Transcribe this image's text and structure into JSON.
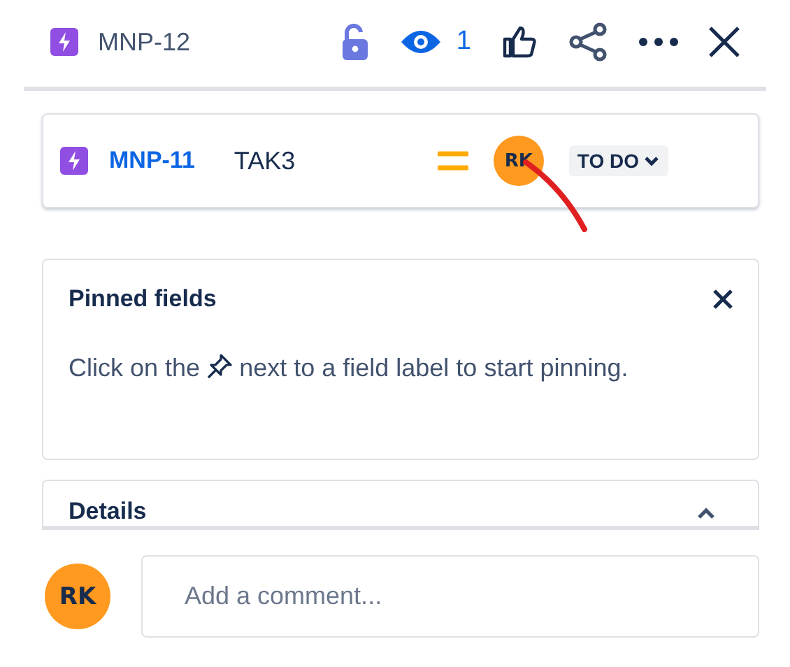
{
  "header": {
    "issue_key": "MNP-12",
    "watchers": "1"
  },
  "child_issue": {
    "key": "MNP-11",
    "summary": "TAK3",
    "assignee": "RK",
    "status": "TO DO"
  },
  "pinned_fields": {
    "title": "Pinned fields",
    "text_before": "Click on the",
    "text_after": "next to a field label to start pinning."
  },
  "details": {
    "title": "Details",
    "expanded": true
  },
  "comment": {
    "avatar": "RK",
    "placeholder": "Add a comment..."
  }
}
